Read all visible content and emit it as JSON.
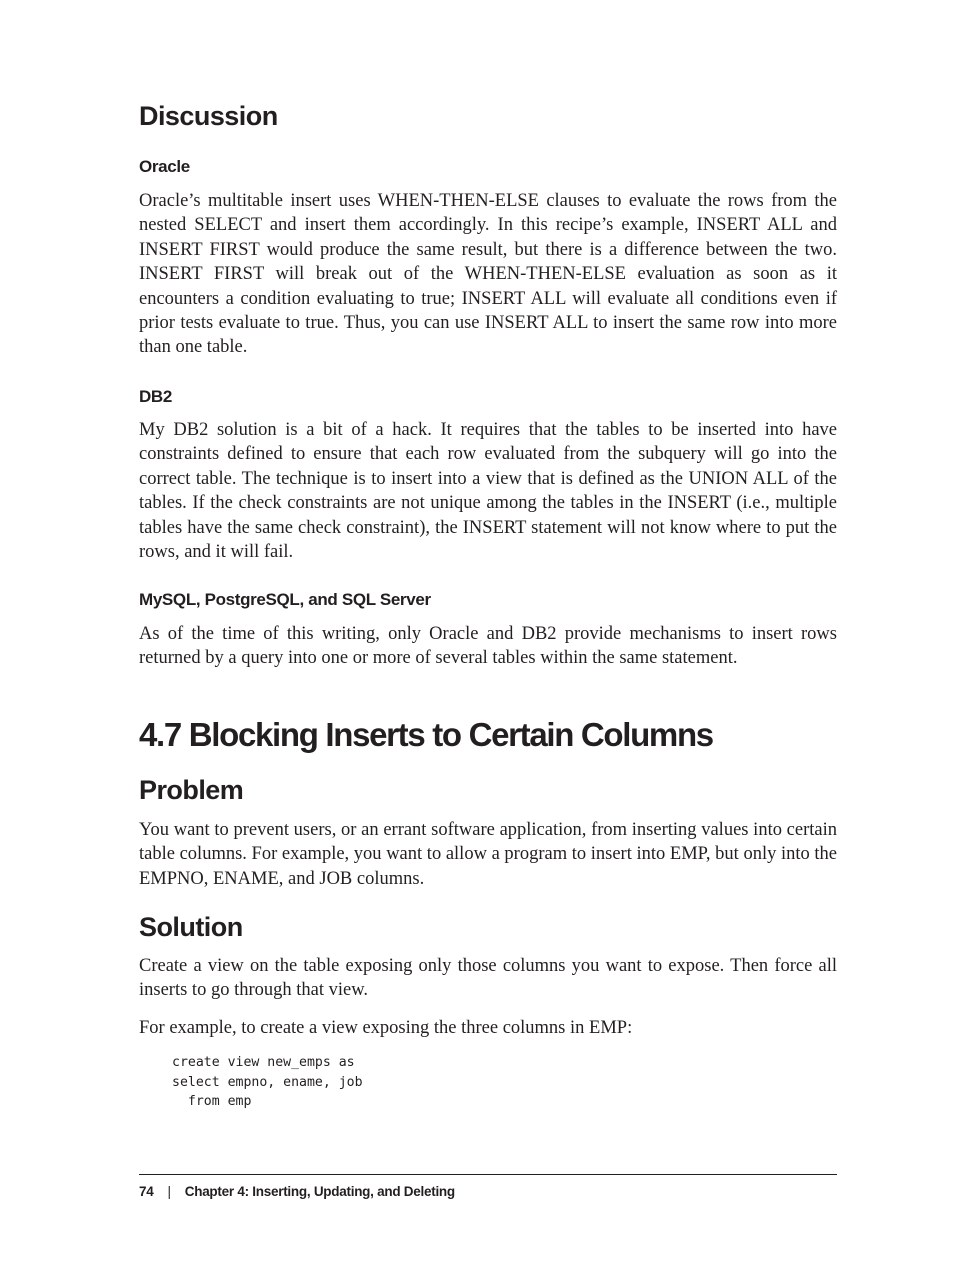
{
  "discussion": {
    "heading": "Discussion",
    "oracle": {
      "heading": "Oracle",
      "text": "Oracle’s multitable insert uses WHEN-THEN-ELSE clauses to evaluate the rows from the nested SELECT and insert them accordingly. In this recipe’s example, INSERT ALL and INSERT FIRST would produce the same result, but there is a difference between the two. INSERT FIRST will break out of the WHEN-THEN-ELSE evaluation as soon as it encounters a condition evaluating to true; INSERT ALL will evaluate all conditions even if prior tests evaluate to true. Thus, you can use INSERT ALL to insert the same row into more than one table."
    },
    "db2": {
      "heading": "DB2",
      "text": "My DB2 solution is a bit of a hack. It requires that the tables to be inserted into have constraints defined to ensure that each row evaluated from the subquery will go into the correct table. The technique is to insert into a view that is defined as the UNION ALL of the tables. If the check constraints are not unique among the tables in the INSERT (i.e., multiple tables have the same check constraint), the INSERT statement will not know where to put the rows, and it will fail."
    },
    "others": {
      "heading": "MySQL, PostgreSQL, and SQL Server",
      "text": "As of the time of this writing, only Oracle and DB2 provide mechanisms to insert rows returned by a query into one or more of several tables within the same statement."
    }
  },
  "section": {
    "title": "4.7 Blocking Inserts to Certain Columns",
    "problem": {
      "heading": "Problem",
      "text": "You want to prevent users, or an errant software application, from inserting values into certain table columns. For example, you want to allow a program to insert into EMP, but only into the EMPNO, ENAME, and JOB columns."
    },
    "solution": {
      "heading": "Solution",
      "text1": "Create a view on the table exposing only those columns you want to expose. Then force all inserts to go through that view.",
      "text2": "For example, to create a view exposing the three columns in EMP:",
      "code": "create view new_emps as\nselect empno, ename, job\n  from emp"
    }
  },
  "footer": {
    "page_number": "74",
    "separator": "|",
    "chapter": "Chapter 4: Inserting, Updating, and Deleting"
  }
}
